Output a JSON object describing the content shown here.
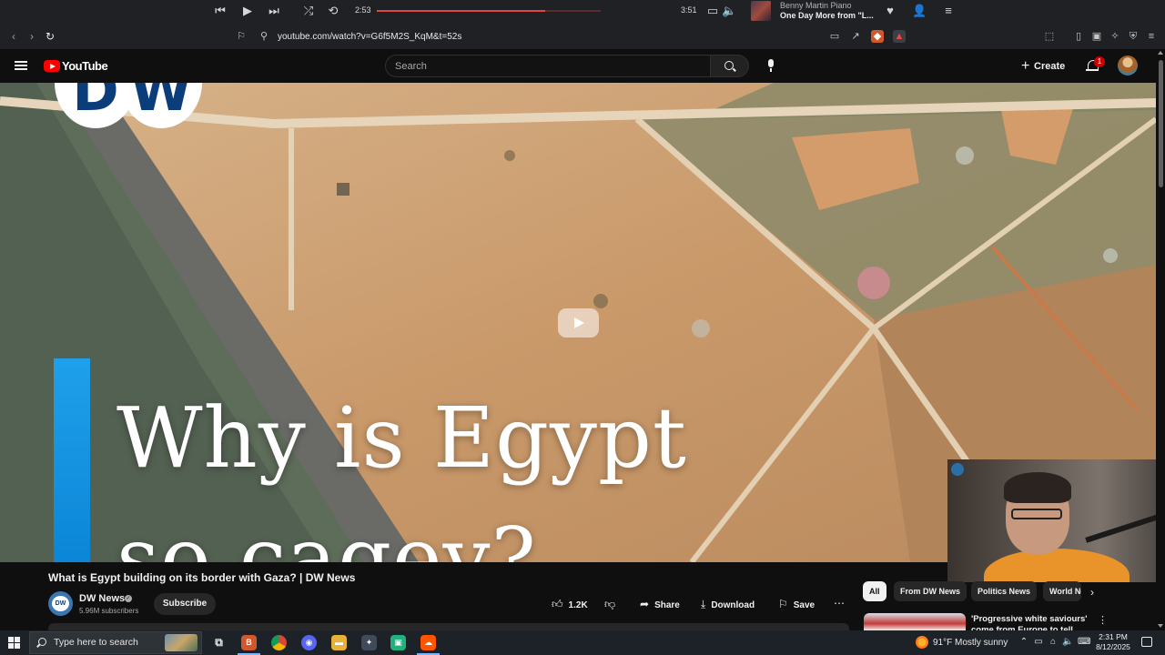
{
  "media_bar": {
    "current_time": "2:53",
    "total_time": "3:51",
    "progress": 0.75,
    "artist": "Benny Martin Piano",
    "track": "One Day More from \"L..."
  },
  "browser": {
    "url": "youtube.com/watch?v=G6f5M2S_KqM&t=52s"
  },
  "youtube": {
    "logo_text": "YouTube",
    "search_placeholder": "Search",
    "create_label": "Create",
    "notification_count": "1"
  },
  "video": {
    "overlay_headline_line1": "Why is Egypt",
    "overlay_headline_line2": "so cagey?",
    "logo_letters": [
      "D",
      "W"
    ],
    "title": "What is Egypt building on its border with Gaza? | DW News"
  },
  "channel": {
    "name": "DW News",
    "subscribers": "5.96M subscribers",
    "subscribe_label": "Subscribe"
  },
  "actions": {
    "likes": "1.2K",
    "share": "Share",
    "download": "Download",
    "save": "Save"
  },
  "chips": [
    "All",
    "From DW News",
    "Politics News",
    "World News"
  ],
  "recommendation": {
    "title": "'Progressive white saviours' come from Europe to tell Egyp..."
  },
  "taskbar": {
    "search_placeholder": "Type here to search",
    "weather": "91°F  Mostly sunny",
    "time": "2:31 PM",
    "date": "8/12/2025"
  },
  "colors": {
    "accent_red": "#ff0000",
    "dw_blue": "#0a84d6",
    "background": "#0f0f0f"
  }
}
